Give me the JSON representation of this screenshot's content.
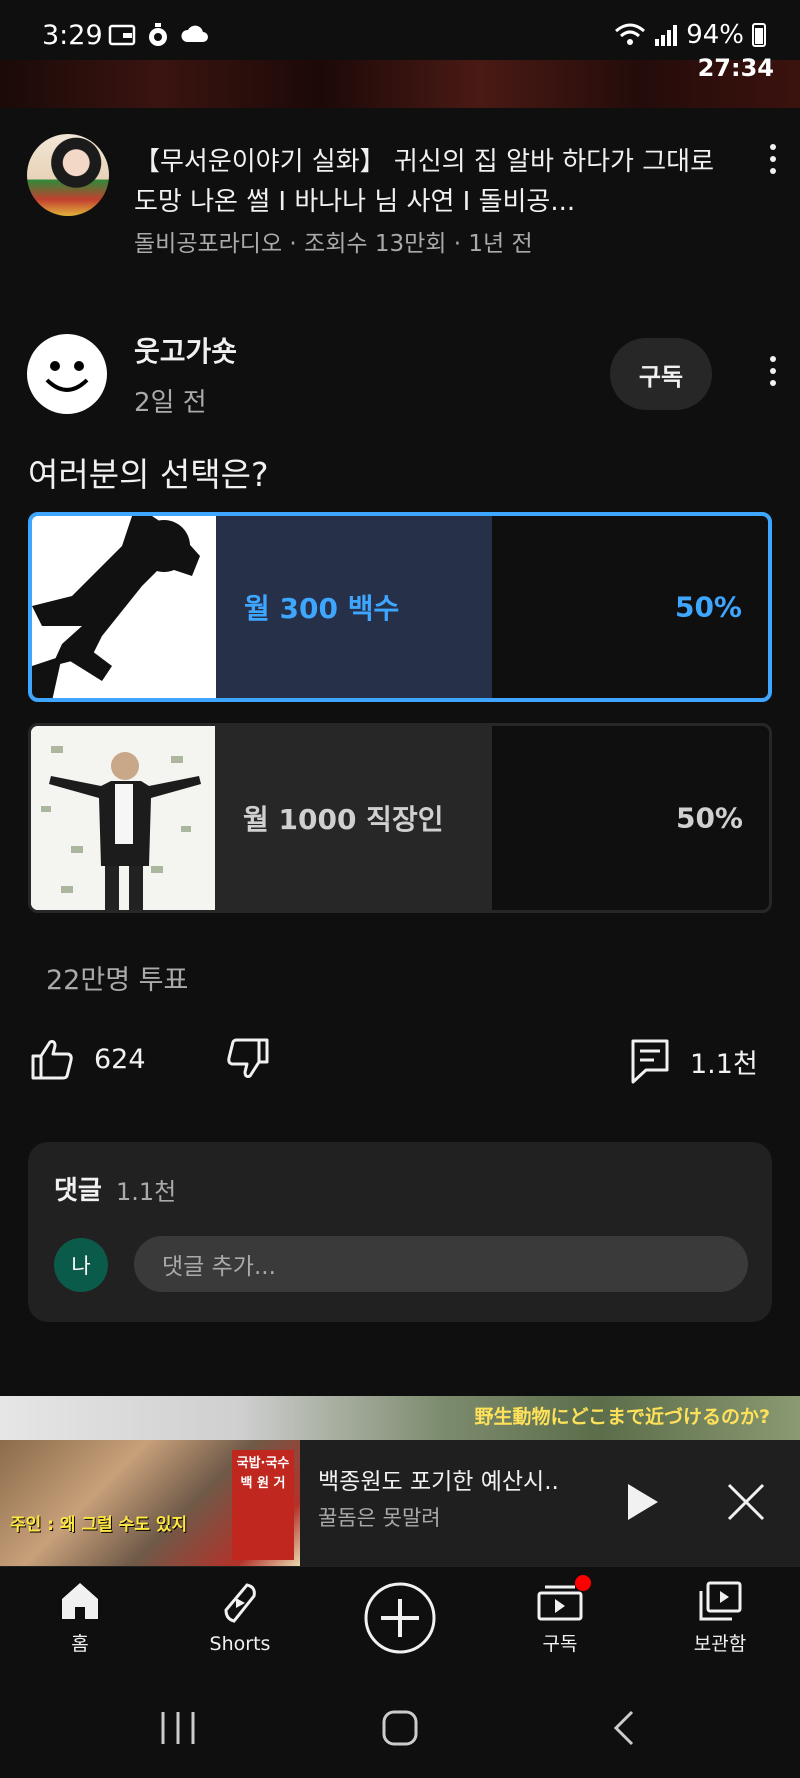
{
  "status_bar": {
    "time": "3:29",
    "battery": "94%"
  },
  "video": {
    "duration": "27:34",
    "title": "【무서운이야기 실화】 귀신의 집 알바 하다가 그대로 도망 나온 썰 I 바나나 님 사연 I 돌비공...",
    "meta": "돌비공포라디오 · 조회수 13만회 · 1년 전"
  },
  "post": {
    "author": "웃고가숏",
    "time": "2일 전",
    "subscribe_label": "구독",
    "question": "여러분의 선택은?",
    "options": [
      {
        "label": "월 300 백수",
        "percent": "50%",
        "fill": 0.5,
        "selected": true
      },
      {
        "label": "월 1000 직장인",
        "percent": "50%",
        "fill": 0.5,
        "selected": false
      }
    ],
    "votes": "22만명 투표"
  },
  "actions": {
    "likes": "624",
    "comments": "1.1천"
  },
  "comments": {
    "title": "댓글",
    "count": "1.1천",
    "avatar_letter": "나",
    "placeholder": "댓글 추가..."
  },
  "background_ad": {
    "text": "野生動物にどこまで近づけるのか?"
  },
  "mini_player": {
    "title": "백종원도 포기한 예산시..",
    "channel": "꿀돔은 못말려",
    "caption": "주인 : 왜 그럴 수도 있지",
    "badge": "국밥·국수 백 원 거"
  },
  "bottom_nav": {
    "home": "홈",
    "shorts": "Shorts",
    "subscriptions": "구독",
    "library": "보관함"
  },
  "colors": {
    "accent": "#3ea6ff",
    "background": "#0f0f0f",
    "notification": "#ff0000"
  }
}
